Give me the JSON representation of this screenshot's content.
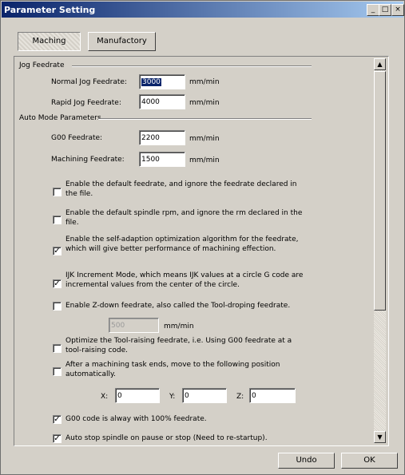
{
  "window": {
    "title": "Parameter Setting",
    "minimize_icon": "_",
    "maximize_icon": "□",
    "close_icon": "×"
  },
  "tabs": [
    {
      "label": "Maching",
      "active": true
    },
    {
      "label": "Manufactory",
      "active": false
    }
  ],
  "jog": {
    "group_label": "Jog Feedrate",
    "normal_label": "Normal Jog Feedrate:",
    "normal_value": "3000",
    "normal_unit": "mm/min",
    "rapid_label": "Rapid Jog Feedrate:",
    "rapid_value": "4000",
    "rapid_unit": "mm/min"
  },
  "auto": {
    "group_label": "Auto Mode Parameters",
    "g00_label": "G00 Feedrate:",
    "g00_value": "2200",
    "g00_unit": "mm/min",
    "mach_label": "Machining Feedrate:",
    "mach_value": "1500",
    "mach_unit": "mm/min"
  },
  "options": [
    {
      "label": "Enable the default feedrate, and ignore the feedrate declared in the file.",
      "checked": false
    },
    {
      "label": "Enable the default spindle rpm, and ignore the rm declared in the file.",
      "checked": false
    },
    {
      "label": "Enable the self-adaption optimization algorithm for the feedrate, which will give better performance of machining effection.",
      "checked": true
    },
    {
      "label": "IJK Increment Mode, which means IJK values at a circle G code are incremental values from the center of the circle.",
      "checked": true
    },
    {
      "label": "Enable Z-down feedrate, also called the Tool-droping feedrate.",
      "checked": false
    },
    {
      "label": "Optimize the Tool-raising feedrate, i.e. Using G00 feedrate at a tool-raising code.",
      "checked": false
    },
    {
      "label": "After a machining task ends, move to the following position automatically.",
      "checked": false
    },
    {
      "label": "G00 code is alway with 100% feedrate.",
      "checked": true
    },
    {
      "label": "Auto stop spindle on pause or stop (Need to re-startup).",
      "checked": true
    }
  ],
  "zdown": {
    "value": "500",
    "unit": "mm/min"
  },
  "position": {
    "x_label": "X:",
    "x_value": "0",
    "y_label": "Y:",
    "y_value": "0",
    "z_label": "Z:",
    "z_value": "0"
  },
  "scrollbar": {
    "up_icon": "▲",
    "down_icon": "▼"
  },
  "buttons": {
    "undo": "Undo",
    "ok": "OK"
  }
}
